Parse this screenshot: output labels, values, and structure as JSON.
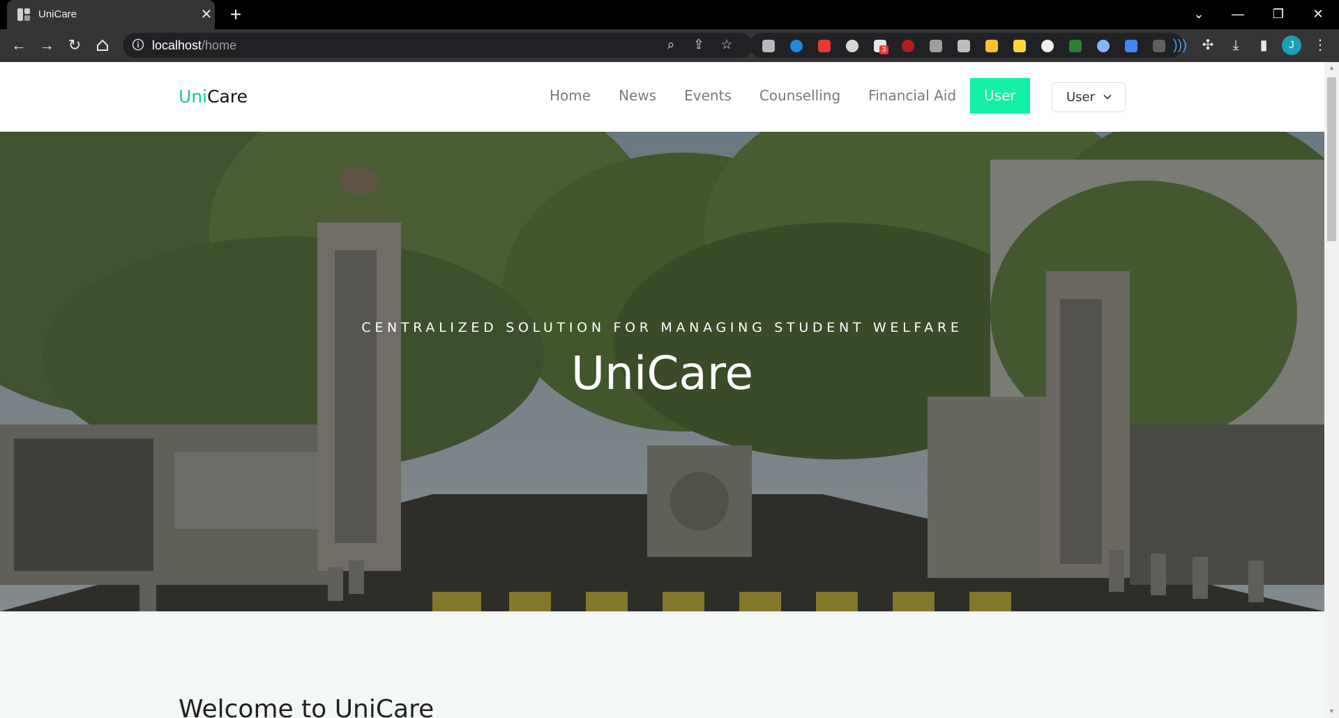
{
  "browser": {
    "tab_title": "UniCare",
    "tab_close": "✕",
    "new_tab": "+",
    "url_host": "localhost",
    "url_path": "/home",
    "extension_badge": "3",
    "profile_initial": "J",
    "window_controls": [
      "⌄",
      "—",
      "❐",
      "✕"
    ],
    "nav_icons": [
      "back-icon",
      "forward-icon",
      "reload-icon",
      "home-icon"
    ]
  },
  "navbar": {
    "brand_prefix": "Uni",
    "brand_suffix": "Care",
    "links": [
      {
        "label": "Home",
        "active": false
      },
      {
        "label": "News",
        "active": false
      },
      {
        "label": "Events",
        "active": false
      },
      {
        "label": "Counselling",
        "active": false
      },
      {
        "label": "Financial Aid",
        "active": false
      },
      {
        "label": "User",
        "active": true
      }
    ],
    "user_dropdown_label": "User"
  },
  "hero": {
    "kicker": "CENTRALIZED SOLUTION FOR MANAGING STUDENT WELFARE",
    "title": "UniCare"
  },
  "section": {
    "heading_partial": "Welcome to UniCare"
  },
  "colors": {
    "accent": "#14f1a6",
    "brand_green": "#17c98f",
    "chrome_dark": "#353535"
  }
}
